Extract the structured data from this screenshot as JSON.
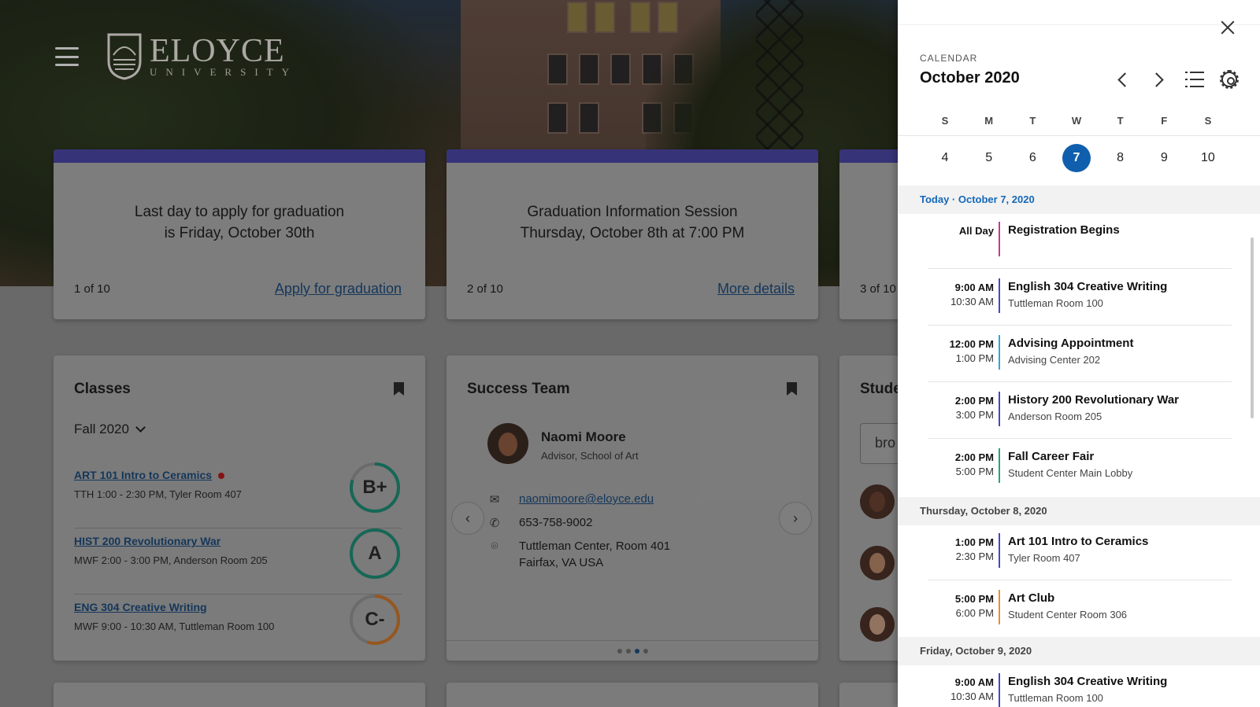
{
  "header": {
    "brand": "ELOYCE",
    "sub": "UNIVERSITY"
  },
  "announcements": [
    {
      "message": "Last day to apply for graduation\nis Friday, October 30th",
      "count": "1 of 10",
      "link": "Apply for graduation"
    },
    {
      "message": "Graduation Information Session\nThursday, October 8th at 7:00 PM",
      "count": "2 of 10",
      "link": "More details"
    },
    {
      "count": "3 of 10"
    }
  ],
  "classes": {
    "title": "Classes",
    "term": "Fall 2020",
    "items": [
      {
        "name": "ART 101 Intro to Ceramics",
        "time": "TTH 1:00 - 2:30 PM, Tyler Room 407",
        "grade": "B+",
        "progress": 0.8,
        "color": "#1e8a73"
      },
      {
        "name": "HIST 200 Revolutionary War",
        "time": "MWF 2:00 - 3:00 PM, Anderson Room 205",
        "grade": "A",
        "progress": 1.0,
        "color": "#1e8a73"
      },
      {
        "name": "ENG 304 Creative Writing",
        "time": "MWF 9:00 - 10:30 AM, Tuttleman Room 100",
        "grade": "C-",
        "progress": 0.55,
        "color": "#c9742a"
      }
    ]
  },
  "success_team": {
    "title": "Success Team",
    "name": "Naomi Moore",
    "role": "Advisor, School of Art",
    "email": "naomimoore@eloyce.edu",
    "phone": "653-758-9002",
    "address1": "Tuttleman Center, Room 401",
    "address2": "Fairfax, VA USA"
  },
  "students": {
    "title": "Stude",
    "search_value": "bro"
  },
  "calendar": {
    "label": "CALENDAR",
    "month": "October 2020",
    "weekdays": [
      "S",
      "M",
      "T",
      "W",
      "T",
      "F",
      "S"
    ],
    "days": [
      "4",
      "5",
      "6",
      "7",
      "8",
      "9",
      "10"
    ],
    "today_heading": "Today · October 7, 2020",
    "thu_heading": "Thursday, October 8, 2020",
    "fri_heading": "Friday, October 9, 2020",
    "events": [
      {
        "t1": "All Day",
        "t2": "",
        "title": "Registration Begins",
        "loc": "",
        "color": "#c0399a"
      },
      {
        "t1": "9:00 AM",
        "t2": "10:30 AM",
        "title": "English 304 Creative Writing",
        "loc": "Tuttleman Room 100",
        "color": "#4b46b8"
      },
      {
        "t1": "12:00 PM",
        "t2": "1:00 PM",
        "title": "Advising Appointment",
        "loc": "Advising Center 202",
        "color": "#35a6d6"
      },
      {
        "t1": "2:00 PM",
        "t2": "3:00 PM",
        "title": "History 200 Revolutionary War",
        "loc": "Anderson Room 205",
        "color": "#4b46b8"
      },
      {
        "t1": "2:00 PM",
        "t2": "5:00 PM",
        "title": "Fall Career Fair",
        "loc": "Student Center Main Lobby",
        "color": "#27a37e"
      },
      {
        "t1": "1:00 PM",
        "t2": "2:30 PM",
        "title": "Art 101 Intro to Ceramics",
        "loc": "Tyler Room 407",
        "color": "#4b46b8"
      },
      {
        "t1": "5:00 PM",
        "t2": "6:00 PM",
        "title": "Art Club",
        "loc": "Student Center Room 306",
        "color": "#e8902c"
      },
      {
        "t1": "9:00 AM",
        "t2": "10:30 AM",
        "title": "English 304 Creative Writing",
        "loc": "Tuttleman Room 100",
        "color": "#4b46b8"
      }
    ]
  }
}
